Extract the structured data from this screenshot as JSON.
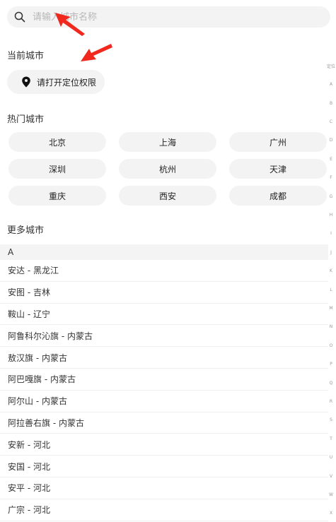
{
  "search": {
    "placeholder": "请输入城市名称"
  },
  "current_city": {
    "title": "当前城市",
    "locate_label": "请打开定位权限"
  },
  "hot_cities": {
    "title": "热门城市",
    "items": [
      "北京",
      "上海",
      "广州",
      "深圳",
      "杭州",
      "天津",
      "重庆",
      "西安",
      "成都"
    ]
  },
  "more_cities": {
    "title": "更多城市",
    "current_letter": "A",
    "items": [
      "安达 - 黑龙江",
      "安图 - 吉林",
      "鞍山 - 辽宁",
      "阿鲁科尔沁旗 - 内蒙古",
      "敖汉旗 - 内蒙古",
      "阿巴嘎旗 - 内蒙古",
      "阿尔山 - 内蒙古",
      "阿拉善右旗 - 内蒙古",
      "安新 - 河北",
      "安国 - 河北",
      "安平 - 河北",
      "广宗 - 河北"
    ]
  },
  "index_bar": [
    "定位",
    "A",
    "B",
    "C",
    "D",
    "E",
    "F",
    "G",
    "H",
    "I",
    "J",
    "K",
    "L",
    "M",
    "N",
    "O",
    "P",
    "Q",
    "R",
    "S",
    "T",
    "U",
    "V",
    "W",
    "X"
  ],
  "colors": {
    "annotation_arrow": "#f0281e",
    "chip_bg": "#f3f3f3"
  }
}
